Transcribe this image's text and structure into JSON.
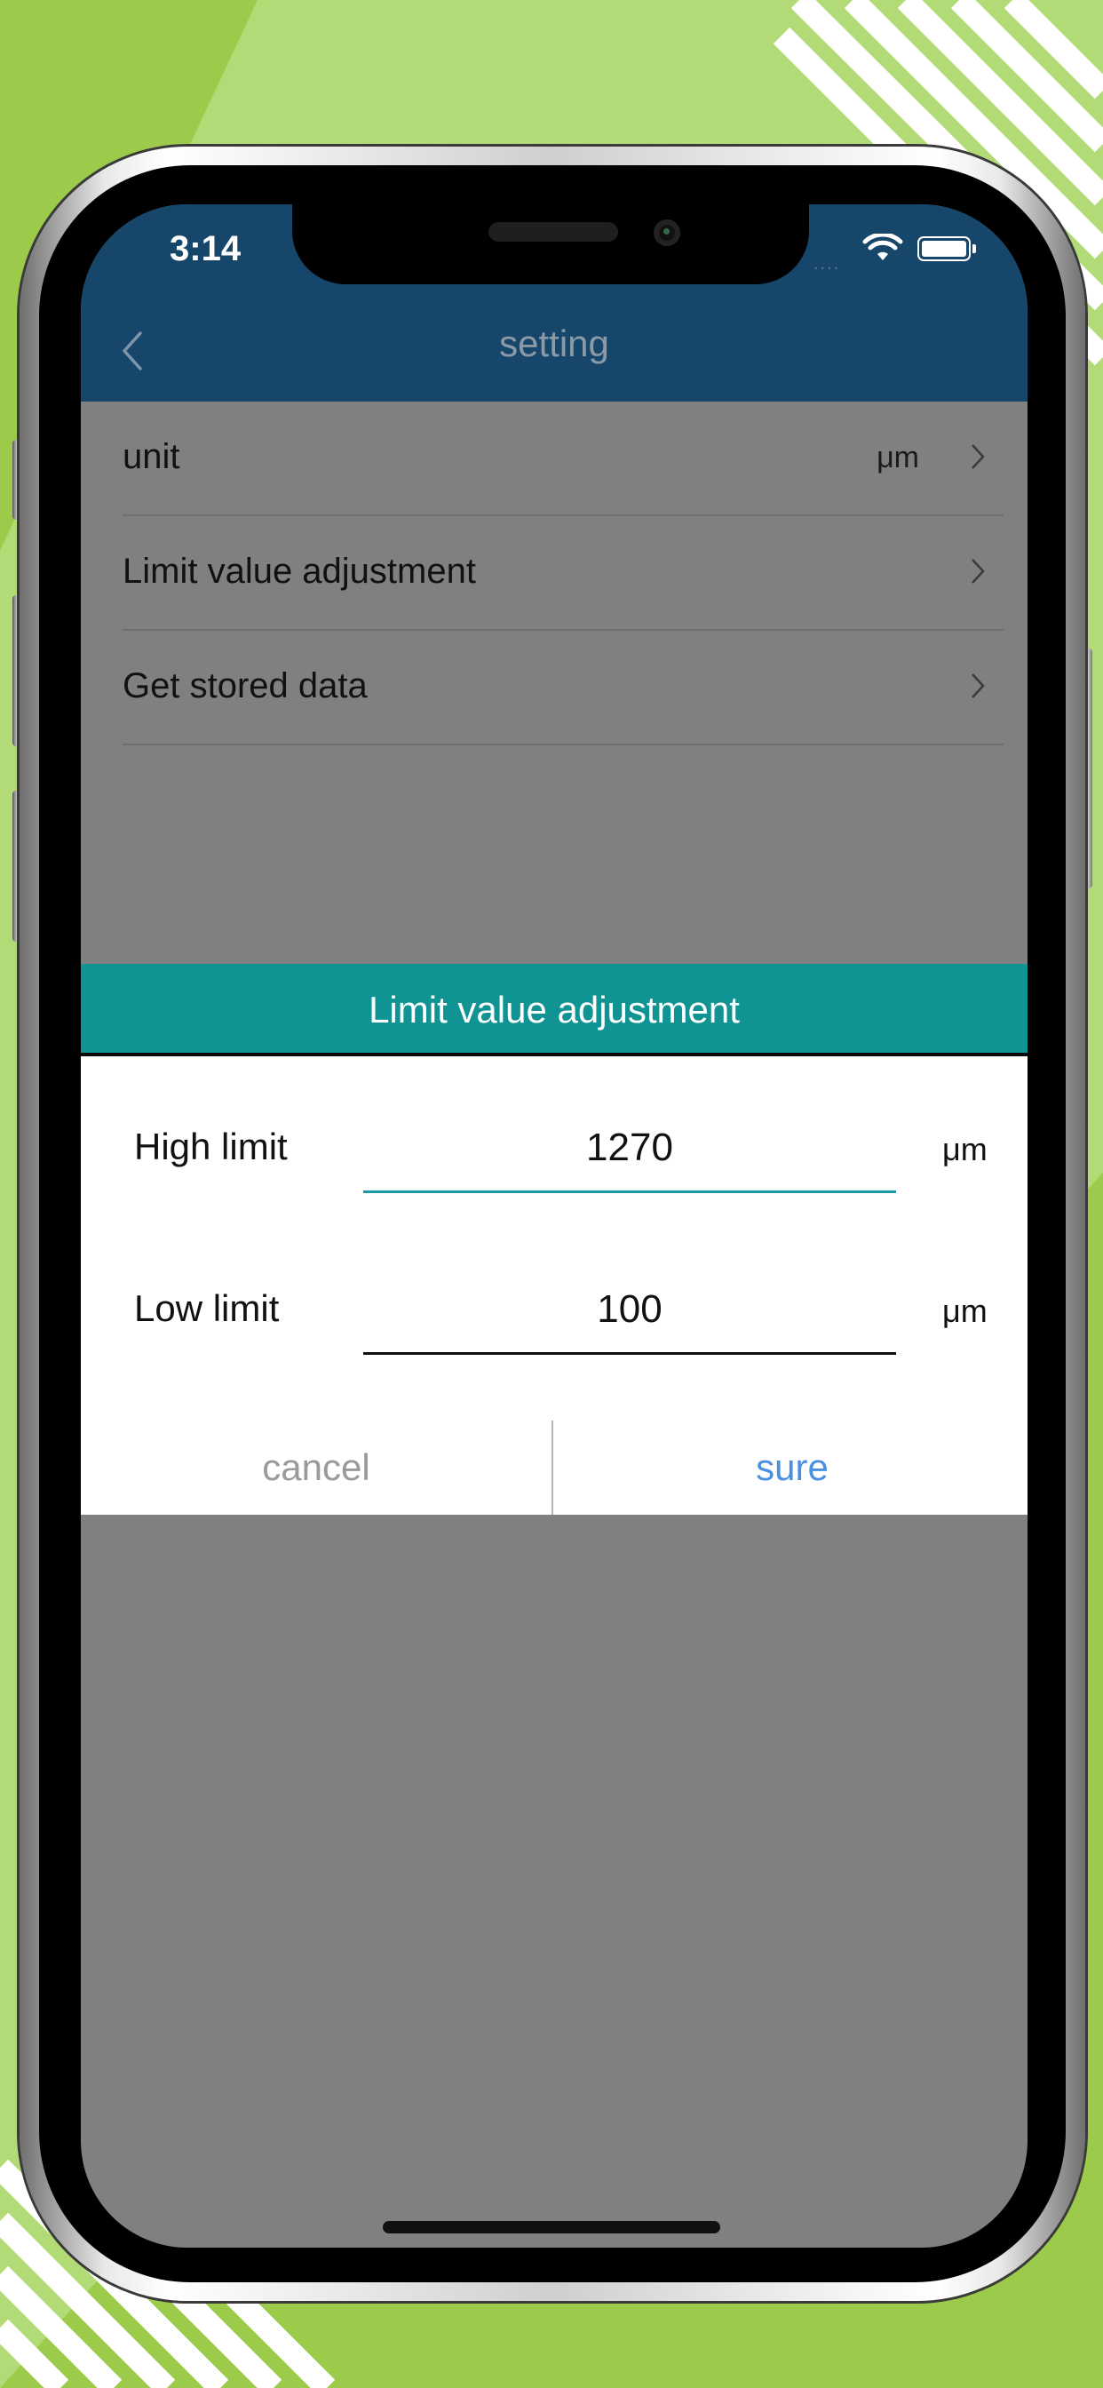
{
  "status_bar": {
    "time": "3:14",
    "signal": "....",
    "wifi_icon": "wifi-icon",
    "battery_icon": "battery-full-icon"
  },
  "nav": {
    "title": "setting",
    "back_icon": "chevron-left-icon"
  },
  "settings": {
    "items": [
      {
        "label": "unit",
        "value": "μm"
      },
      {
        "label": "Limit value adjustment",
        "value": ""
      },
      {
        "label": "Get stored data",
        "value": ""
      }
    ]
  },
  "dialog": {
    "title": "Limit value adjustment",
    "high_limit": {
      "label": "High limit",
      "value": "1270",
      "unit": "μm"
    },
    "low_limit": {
      "label": "Low limit",
      "value": "100",
      "unit": "μm"
    },
    "cancel_label": "cancel",
    "sure_label": "sure"
  },
  "colors": {
    "nav_bg": "#16476b",
    "dialog_header_bg": "#0f9393",
    "overlay": "#808080",
    "sure_text": "#4a90e2",
    "cancel_text": "#9a9a9a",
    "background_green": "#9ccb4b"
  }
}
